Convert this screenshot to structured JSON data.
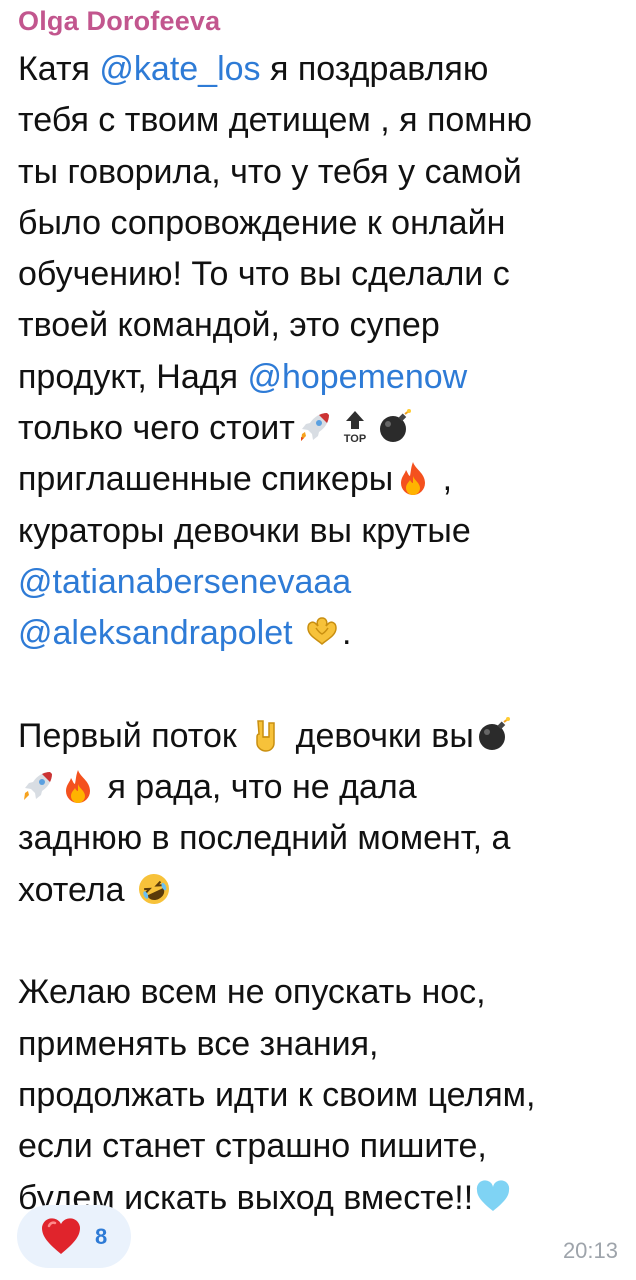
{
  "message": {
    "sender": "Olga Dorofeeva",
    "lines": {
      "l1_pre": "Катя ",
      "l1_mention": "@kate_los",
      "l1_post": "  я поздравляю",
      "l2": "тебя с твоим детищем , я помню",
      "l3": "ты говорила, что у тебя у самой",
      "l4": "было сопровождение к онлайн",
      "l5": "обучению! То что вы сделали с",
      "l6": "твоей командой, это супер",
      "l7_pre": "продукт, Надя ",
      "l7_mention": "@hopemenow",
      "l8": "только чего стоит",
      "l9_pre": "приглашенные спикеры",
      "l9_post": " ,",
      "l10": "кураторы девочки вы крутые",
      "l11_mention": "@tatianabersenevaaa",
      "l12_mention": "@aleksandrapolet",
      "l12_post": ".",
      "l14_pre": "Первый поток ",
      "l14_post": " девочки вы",
      "l15_post": " я рада, что не дала",
      "l16": "заднюю в последний момент, а",
      "l17": "хотела ",
      "l19": "Желаю всем не опускать нос,",
      "l20": "применять все знания,",
      "l21": "продолжать идти к своим целям,",
      "l22": "если станет страшно пишите,",
      "l23": "будем искать выход вместе!!"
    },
    "emojis": [
      "rocket-icon",
      "top-arrow-icon",
      "bomb-icon",
      "fire-icon",
      "heart-hands-icon",
      "rock-on-icon",
      "rofl-icon",
      "light-blue-heart-icon"
    ]
  },
  "reaction": {
    "emoji": "red-heart-icon",
    "count": "8"
  },
  "time": "20:13",
  "colors": {
    "sender": "#c2568e",
    "mention": "#2e7bd6",
    "text": "#111111",
    "reaction_bg": "#eaf2fc",
    "timestamp": "#9ea4ab"
  }
}
